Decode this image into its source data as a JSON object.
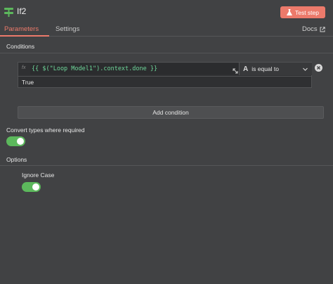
{
  "header": {
    "title": "If2",
    "icon": "if-node-icon",
    "test_button_label": "Test step",
    "test_button_icon": "flask-icon"
  },
  "tabs": [
    {
      "label": "Parameters",
      "active": true
    },
    {
      "label": "Settings",
      "active": false
    }
  ],
  "docs": {
    "label": "Docs",
    "icon": "external-link-icon"
  },
  "conditions": {
    "section_label": "Conditions",
    "items": [
      {
        "fx_label": "fx",
        "left_value": "{{ $(\"Loop Model1\").context.done }}",
        "operator_type": "A",
        "operator_label": "is equal to",
        "right_value": "True"
      }
    ],
    "add_label": "Add condition"
  },
  "convert_types": {
    "label": "Convert types where required",
    "enabled": true
  },
  "options": {
    "section_label": "Options",
    "ignore_case": {
      "label": "Ignore Case",
      "enabled": true
    }
  },
  "colors": {
    "accent": "#ec7a6b",
    "toggle_on": "#5cb85c",
    "expression": "#6fd89b",
    "background": "#414244"
  }
}
